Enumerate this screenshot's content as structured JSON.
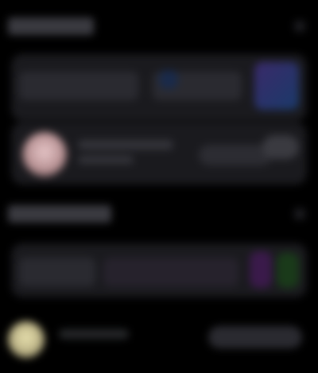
{
  "sections": [
    {
      "title": "",
      "has_corner_icon": true
    },
    {
      "title": "",
      "has_corner_icon": true
    }
  ],
  "cards": [
    {
      "chips": [
        "",
        ""
      ],
      "accent_colors": [
        "#3a2a6a",
        "#1a3a6a"
      ]
    },
    {
      "title": "",
      "subtitle": "",
      "avatar_color": "#d8b6b8"
    },
    {
      "chips": [
        "",
        ""
      ],
      "accent_colors": [
        "#5a2a6a",
        "#2a5a2a"
      ]
    }
  ],
  "footer": {
    "title": "",
    "action": "",
    "avatar_color": "#e9e2b0"
  },
  "colors": {
    "background": "#000000",
    "card": "#1a1a1e",
    "chip": "#2a2a30"
  }
}
